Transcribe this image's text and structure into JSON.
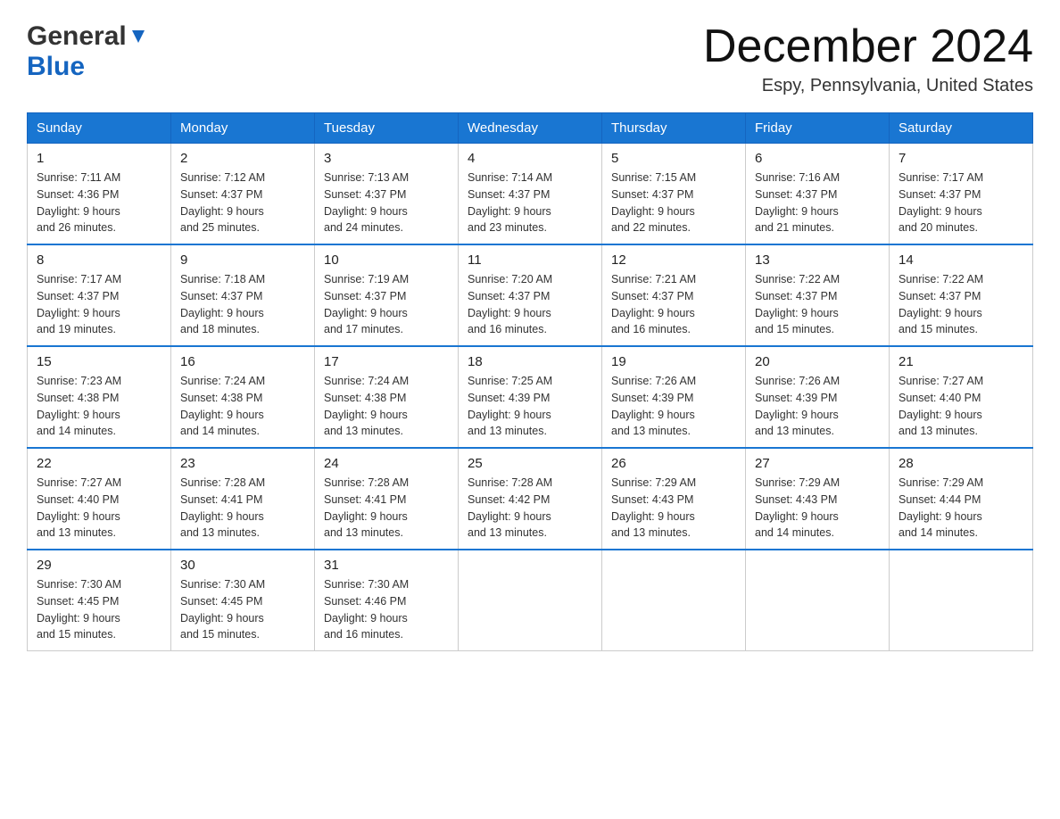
{
  "header": {
    "logo_general": "General",
    "logo_blue": "Blue",
    "month_title": "December 2024",
    "location": "Espy, Pennsylvania, United States"
  },
  "days_of_week": [
    "Sunday",
    "Monday",
    "Tuesday",
    "Wednesday",
    "Thursday",
    "Friday",
    "Saturday"
  ],
  "weeks": [
    [
      {
        "day": "1",
        "sunrise": "7:11 AM",
        "sunset": "4:36 PM",
        "daylight": "9 hours and 26 minutes."
      },
      {
        "day": "2",
        "sunrise": "7:12 AM",
        "sunset": "4:37 PM",
        "daylight": "9 hours and 25 minutes."
      },
      {
        "day": "3",
        "sunrise": "7:13 AM",
        "sunset": "4:37 PM",
        "daylight": "9 hours and 24 minutes."
      },
      {
        "day": "4",
        "sunrise": "7:14 AM",
        "sunset": "4:37 PM",
        "daylight": "9 hours and 23 minutes."
      },
      {
        "day": "5",
        "sunrise": "7:15 AM",
        "sunset": "4:37 PM",
        "daylight": "9 hours and 22 minutes."
      },
      {
        "day": "6",
        "sunrise": "7:16 AM",
        "sunset": "4:37 PM",
        "daylight": "9 hours and 21 minutes."
      },
      {
        "day": "7",
        "sunrise": "7:17 AM",
        "sunset": "4:37 PM",
        "daylight": "9 hours and 20 minutes."
      }
    ],
    [
      {
        "day": "8",
        "sunrise": "7:17 AM",
        "sunset": "4:37 PM",
        "daylight": "9 hours and 19 minutes."
      },
      {
        "day": "9",
        "sunrise": "7:18 AM",
        "sunset": "4:37 PM",
        "daylight": "9 hours and 18 minutes."
      },
      {
        "day": "10",
        "sunrise": "7:19 AM",
        "sunset": "4:37 PM",
        "daylight": "9 hours and 17 minutes."
      },
      {
        "day": "11",
        "sunrise": "7:20 AM",
        "sunset": "4:37 PM",
        "daylight": "9 hours and 16 minutes."
      },
      {
        "day": "12",
        "sunrise": "7:21 AM",
        "sunset": "4:37 PM",
        "daylight": "9 hours and 16 minutes."
      },
      {
        "day": "13",
        "sunrise": "7:22 AM",
        "sunset": "4:37 PM",
        "daylight": "9 hours and 15 minutes."
      },
      {
        "day": "14",
        "sunrise": "7:22 AM",
        "sunset": "4:37 PM",
        "daylight": "9 hours and 15 minutes."
      }
    ],
    [
      {
        "day": "15",
        "sunrise": "7:23 AM",
        "sunset": "4:38 PM",
        "daylight": "9 hours and 14 minutes."
      },
      {
        "day": "16",
        "sunrise": "7:24 AM",
        "sunset": "4:38 PM",
        "daylight": "9 hours and 14 minutes."
      },
      {
        "day": "17",
        "sunrise": "7:24 AM",
        "sunset": "4:38 PM",
        "daylight": "9 hours and 13 minutes."
      },
      {
        "day": "18",
        "sunrise": "7:25 AM",
        "sunset": "4:39 PM",
        "daylight": "9 hours and 13 minutes."
      },
      {
        "day": "19",
        "sunrise": "7:26 AM",
        "sunset": "4:39 PM",
        "daylight": "9 hours and 13 minutes."
      },
      {
        "day": "20",
        "sunrise": "7:26 AM",
        "sunset": "4:39 PM",
        "daylight": "9 hours and 13 minutes."
      },
      {
        "day": "21",
        "sunrise": "7:27 AM",
        "sunset": "4:40 PM",
        "daylight": "9 hours and 13 minutes."
      }
    ],
    [
      {
        "day": "22",
        "sunrise": "7:27 AM",
        "sunset": "4:40 PM",
        "daylight": "9 hours and 13 minutes."
      },
      {
        "day": "23",
        "sunrise": "7:28 AM",
        "sunset": "4:41 PM",
        "daylight": "9 hours and 13 minutes."
      },
      {
        "day": "24",
        "sunrise": "7:28 AM",
        "sunset": "4:41 PM",
        "daylight": "9 hours and 13 minutes."
      },
      {
        "day": "25",
        "sunrise": "7:28 AM",
        "sunset": "4:42 PM",
        "daylight": "9 hours and 13 minutes."
      },
      {
        "day": "26",
        "sunrise": "7:29 AM",
        "sunset": "4:43 PM",
        "daylight": "9 hours and 13 minutes."
      },
      {
        "day": "27",
        "sunrise": "7:29 AM",
        "sunset": "4:43 PM",
        "daylight": "9 hours and 14 minutes."
      },
      {
        "day": "28",
        "sunrise": "7:29 AM",
        "sunset": "4:44 PM",
        "daylight": "9 hours and 14 minutes."
      }
    ],
    [
      {
        "day": "29",
        "sunrise": "7:30 AM",
        "sunset": "4:45 PM",
        "daylight": "9 hours and 15 minutes."
      },
      {
        "day": "30",
        "sunrise": "7:30 AM",
        "sunset": "4:45 PM",
        "daylight": "9 hours and 15 minutes."
      },
      {
        "day": "31",
        "sunrise": "7:30 AM",
        "sunset": "4:46 PM",
        "daylight": "9 hours and 16 minutes."
      },
      null,
      null,
      null,
      null
    ]
  ],
  "labels": {
    "sunrise": "Sunrise:",
    "sunset": "Sunset:",
    "daylight": "Daylight:"
  }
}
